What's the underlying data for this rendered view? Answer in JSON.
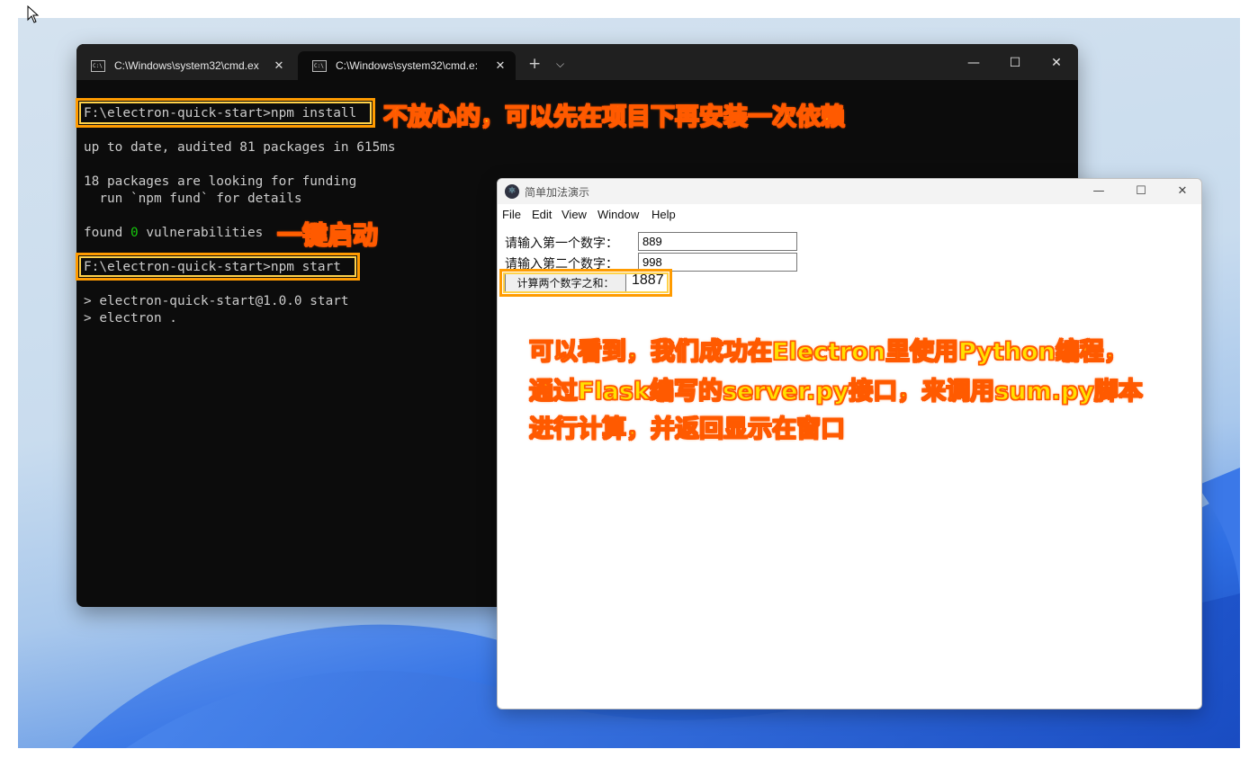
{
  "terminal": {
    "tabs": [
      {
        "label": "C:\\Windows\\system32\\cmd.ex",
        "close": "✕"
      },
      {
        "label": "C:\\Windows\\system32\\cmd.e:",
        "close": "✕"
      }
    ],
    "new_tab": "+",
    "dropdown": "⌵",
    "controls": {
      "minimize": "—",
      "maximize": "☐",
      "close": "✕"
    },
    "lines": {
      "l1": "F:\\electron-quick-start>npm install",
      "l2": "up to date, audited 81 packages in 615ms",
      "l3": "18 packages are looking for funding",
      "l4": "  run `npm fund` for details",
      "l5_a": "found ",
      "l5_b": "0",
      "l5_c": " vulnerabilities",
      "l6": "F:\\electron-quick-start>npm start",
      "l7": "> electron-quick-start@1.0.0 start",
      "l8": "> electron ."
    }
  },
  "annotations": {
    "a1": "不放心的，可以先在项目下再安装一次依赖",
    "a2": "一键启动",
    "a3_line1": "可以看到，我们成功在Electron里使用Python编程，",
    "a3_line2": "通过Flask编写的server.py接口，来调用sum.py脚本",
    "a3_line3": "进行计算，并返回显示在窗口"
  },
  "electron": {
    "title": "简单加法演示",
    "logo": "⚛",
    "controls": {
      "minimize": "—",
      "maximize": "☐",
      "close": "✕"
    },
    "menu": [
      "File",
      "Edit",
      "View",
      "Window",
      "Help"
    ],
    "label1": "请输入第一个数字：",
    "input1": "889",
    "label2": "请输入第二个数字：",
    "input2": "998",
    "button": "计算两个数字之和：",
    "result": "1887"
  },
  "colors": {
    "highlight_border": "#ff9b00",
    "annotation_text": "#ffe100",
    "annotation_stroke": "#ff5a00",
    "terminal_bg": "#0c0c0c",
    "success_green": "#16c60c"
  }
}
